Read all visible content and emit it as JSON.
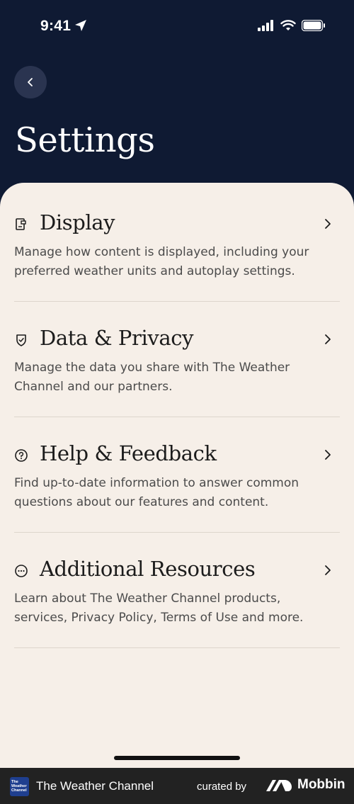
{
  "status_bar": {
    "time": "9:41"
  },
  "header": {
    "title": "Settings"
  },
  "items": [
    {
      "title": "Display",
      "description": "Manage how content is displayed, including your preferred weather units and autoplay settings.",
      "icon": "display-settings-icon"
    },
    {
      "title": "Data & Privacy",
      "description": "Manage the data you share with The Weather Channel and our partners.",
      "icon": "shield-icon"
    },
    {
      "title": "Help & Feedback",
      "description": "Find up-to-date information to answer common questions about our features and content.",
      "icon": "question-circle-icon"
    },
    {
      "title": "Additional Resources",
      "description": "Learn about The Weather Channel products, services, Privacy Policy, Terms of Use and more.",
      "icon": "more-circle-icon"
    }
  ],
  "footer": {
    "logo_text": "The Weather Channel",
    "app_name": "The Weather Channel",
    "curated_by": "curated by",
    "brand": "Mobbin"
  },
  "colors": {
    "header_bg": "#0f1a33",
    "sheet_bg": "#f6efe8",
    "footer_bg": "#222222"
  }
}
